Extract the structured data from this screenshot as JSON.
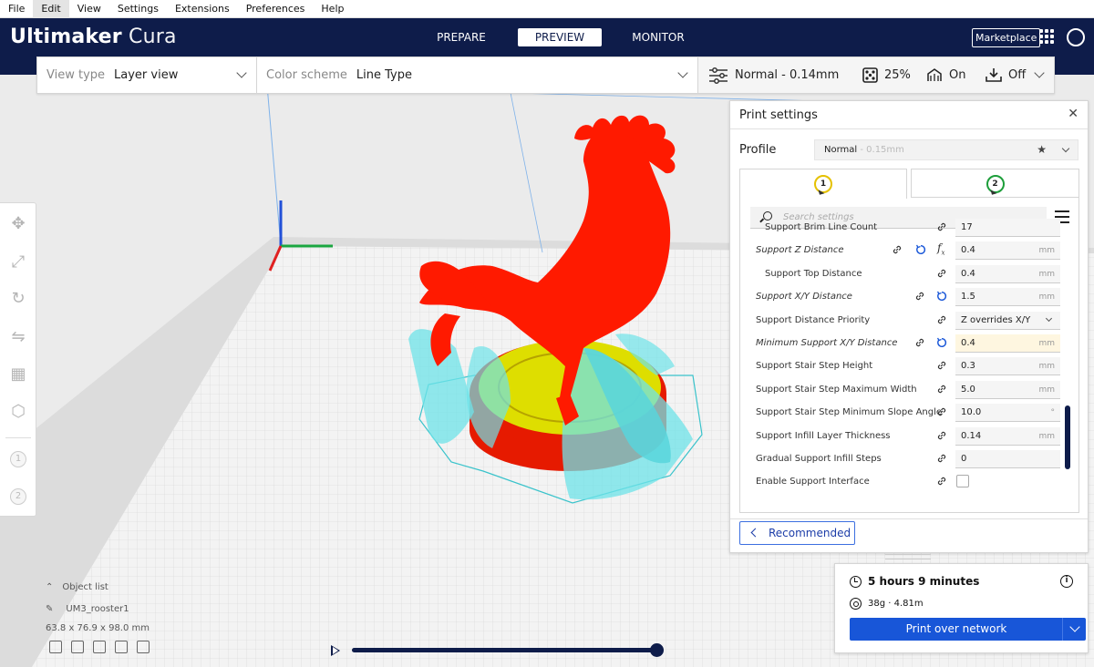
{
  "menu": [
    "File",
    "Edit",
    "View",
    "Settings",
    "Extensions",
    "Preferences",
    "Help"
  ],
  "app": {
    "logo_bold": "Ultimaker",
    "logo_light": "Cura"
  },
  "stages": [
    {
      "label": "PREPARE",
      "active": false
    },
    {
      "label": "PREVIEW",
      "active": true
    },
    {
      "label": "MONITOR",
      "active": false
    }
  ],
  "header": {
    "marketplace": "Marketplace"
  },
  "toolbar": {
    "view_type_label": "View type",
    "view_type_value": "Layer view",
    "color_scheme_label": "Color scheme",
    "color_scheme_value": "Line Type",
    "profile_summary": "Normal - 0.14mm",
    "infill": "25%",
    "support": "On",
    "adhesion": "Off"
  },
  "left_tools": [
    {
      "icon": "move-icon",
      "glyph": "✥"
    },
    {
      "icon": "scale-icon",
      "glyph": "⤢"
    },
    {
      "icon": "rotate-icon",
      "glyph": "↻"
    },
    {
      "icon": "mirror-icon",
      "glyph": "⇋"
    },
    {
      "icon": "per-model-settings-icon",
      "glyph": "▦"
    },
    {
      "icon": "support-blocker-icon",
      "glyph": "⬡"
    }
  ],
  "extruder_badges": [
    "1",
    "2"
  ],
  "object_list": {
    "header": "Object list",
    "object_name": "UM3_rooster1",
    "dimensions": "63.8 x 76.9 x 98.0 mm"
  },
  "print_settings": {
    "title": "Print settings",
    "profile_label": "Profile",
    "profile_name": "Normal",
    "profile_layer": " - 0.15mm",
    "extruder_tabs": [
      "1",
      "2"
    ],
    "search_placeholder": "Search settings",
    "recommended_label": "Recommended",
    "rows": [
      {
        "name": "Support Brim Line Count",
        "value": "17",
        "unit": "",
        "indent": true
      },
      {
        "name": "Support Z Distance",
        "value": "0.4",
        "unit": "mm",
        "italic": true
      },
      {
        "name": "Support Top Distance",
        "value": "0.4",
        "unit": "mm",
        "indent": true
      },
      {
        "name": "Support X/Y Distance",
        "value": "1.5",
        "unit": "mm",
        "italic": true
      },
      {
        "name": "Support Distance Priority",
        "value": "Z overrides X/Y",
        "unit": ""
      },
      {
        "name": "Minimum Support X/Y Distance",
        "value": "0.4",
        "unit": "mm",
        "italic": true
      },
      {
        "name": "Support Stair Step Height",
        "value": "0.3",
        "unit": "mm"
      },
      {
        "name": "Support Stair Step Maximum Width",
        "value": "5.0",
        "unit": "mm"
      },
      {
        "name": "Support Stair Step Minimum Slope Angle",
        "value": "10.0",
        "unit": "°"
      },
      {
        "name": "Support Infill Layer Thickness",
        "value": "0.14",
        "unit": "mm"
      },
      {
        "name": "Gradual Support Infill Steps",
        "value": "0",
        "unit": ""
      },
      {
        "name": "Enable Support Interface",
        "value": "",
        "unit": ""
      }
    ]
  },
  "action_panel": {
    "print_time": "5 hours 9 minutes",
    "material": "38g · 4.81m",
    "button_label": "Print over network"
  },
  "colors": {
    "header_bg": "#0e1c4a",
    "accent": "#1856d8",
    "model_red": "#ff1a00",
    "support_cyan": "#5fe0e6",
    "brim_yellow": "#e6e600",
    "extruder1": "#e5c100",
    "extruder2": "#1d9e3a"
  }
}
